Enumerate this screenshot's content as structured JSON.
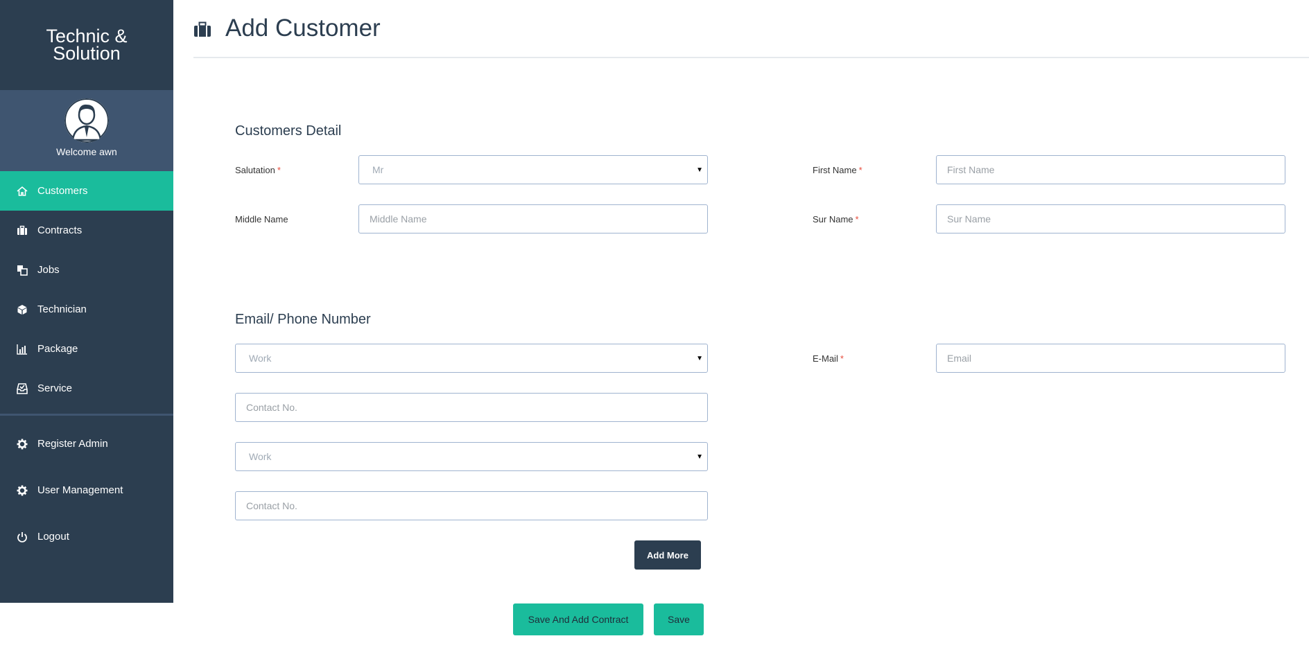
{
  "sidebar": {
    "brand": "Technic & Solution",
    "welcome": "Welcome awn",
    "nav": [
      {
        "label": "Customers",
        "icon": "home-icon"
      },
      {
        "label": "Contracts",
        "icon": "briefcase-icon"
      },
      {
        "label": "Jobs",
        "icon": "copy-icon"
      },
      {
        "label": "Technician",
        "icon": "cube-icon"
      },
      {
        "label": "Package",
        "icon": "bar-chart-icon"
      },
      {
        "label": "Service",
        "icon": "inbox-icon"
      }
    ],
    "admin_nav": [
      {
        "label": "Register Admin",
        "icon": "gear-icon"
      },
      {
        "label": "User Management",
        "icon": "gear-icon"
      },
      {
        "label": "Logout",
        "icon": "power-icon"
      }
    ]
  },
  "header": {
    "title": "Add Customer"
  },
  "customers_detail": {
    "title": "Customers Detail",
    "salutation_label": "Salutation",
    "salutation_value": "Mr",
    "first_name_label": "First Name",
    "first_name_placeholder": "First Name",
    "middle_name_label": "Middle Name",
    "middle_name_placeholder": "Middle Name",
    "sur_name_label": "Sur Name",
    "sur_name_placeholder": "Sur Name",
    "required_mark": "*"
  },
  "contact": {
    "title": "Email/ Phone Number",
    "phone_type_1": "Work",
    "contact_placeholder_1": "Contact No.",
    "phone_type_2": "Work",
    "contact_placeholder_2": "Contact No.",
    "email_label": "E-Mail",
    "email_placeholder": "Email",
    "add_more": "Add More"
  },
  "actions": {
    "save_and_add_contract": "Save And Add Contract",
    "save": "Save"
  },
  "colors": {
    "sidebar": "#2c3e50",
    "profile_band": "#3f5570",
    "accent": "#1abc9c",
    "required": "#e74c3c"
  }
}
